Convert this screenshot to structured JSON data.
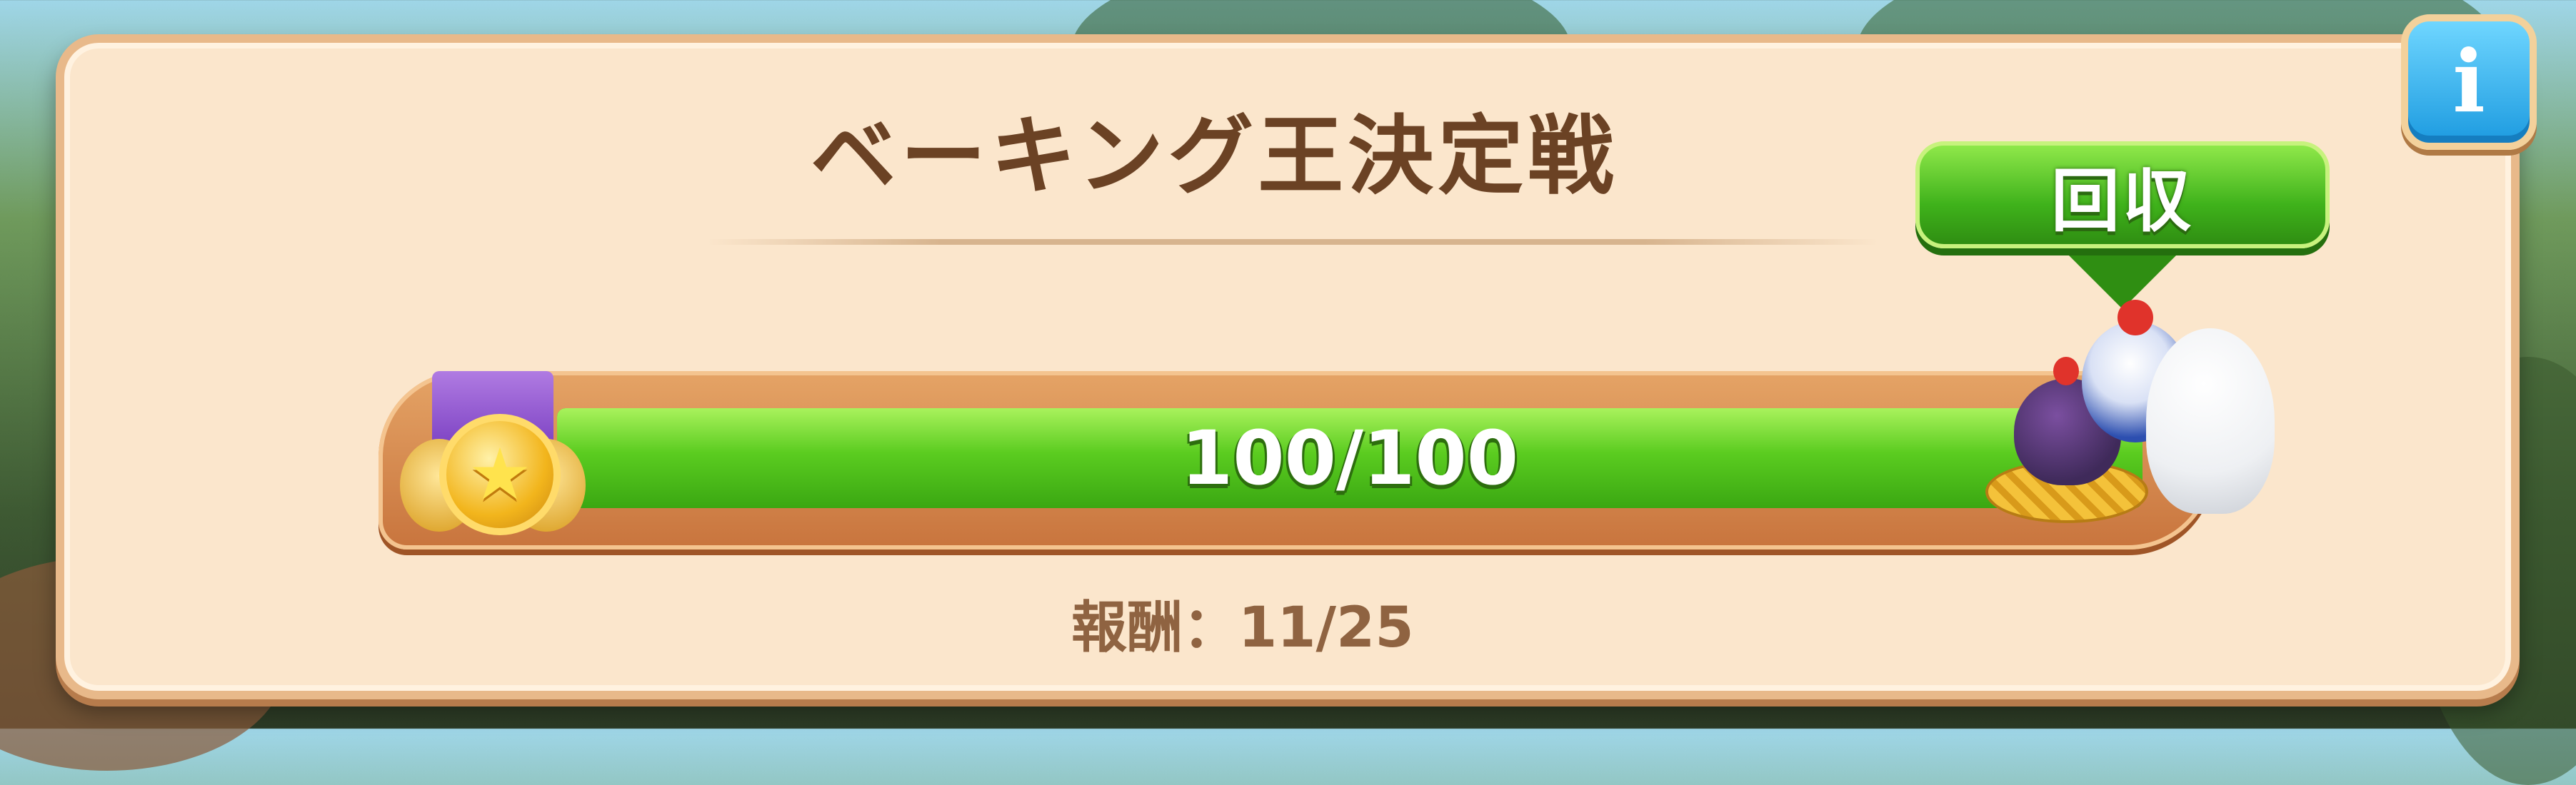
{
  "event": {
    "title": "ベーキング王決定戦"
  },
  "buttons": {
    "collect_label": "回収",
    "info_icon": "info-icon"
  },
  "progress": {
    "current": 100,
    "max": 100,
    "fraction": 1.0,
    "label": "100/100"
  },
  "reward": {
    "label": "報酬：",
    "value": "11/25"
  },
  "icons": {
    "medal": "medal-star-icon",
    "chickens": "chickens-icon"
  },
  "colors": {
    "panel_bg": "#fbe6cc",
    "title": "#6b4224",
    "progress_fill": "#5bcc20",
    "button_green": "#3fb21b",
    "info_blue": "#1d9be0"
  }
}
